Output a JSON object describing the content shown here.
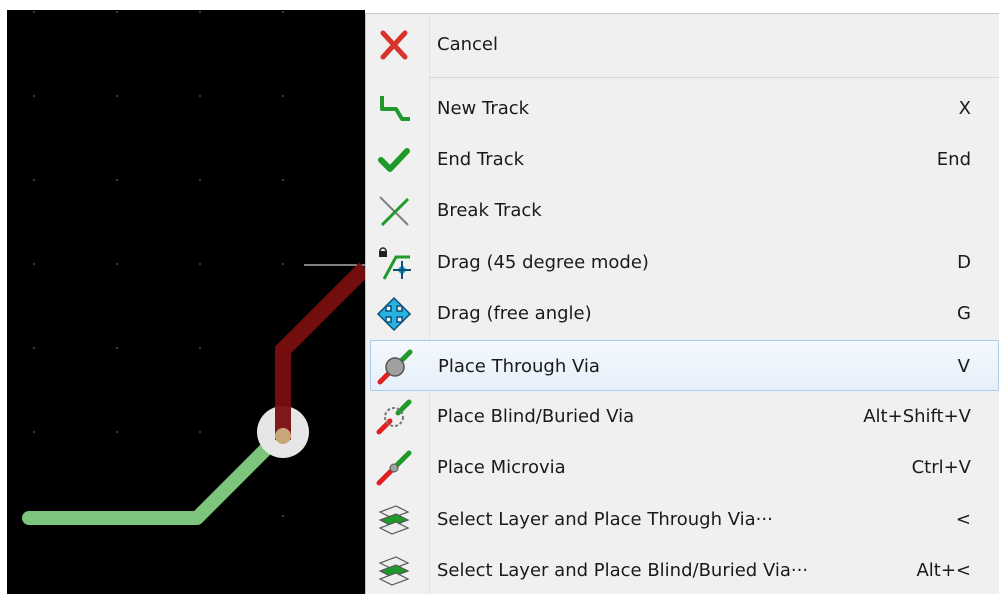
{
  "menu": {
    "items": [
      {
        "label": "Cancel",
        "shortcut": "",
        "icon": "cancel-x-icon"
      },
      {
        "label": "New Track",
        "shortcut": "X",
        "icon": "new-track-icon"
      },
      {
        "label": "End Track",
        "shortcut": "End",
        "icon": "checkmark-icon"
      },
      {
        "label": "Break Track",
        "shortcut": "",
        "icon": "break-track-icon"
      },
      {
        "label": "Drag (45 degree mode)",
        "shortcut": "D",
        "icon": "drag-45-icon"
      },
      {
        "label": "Drag (free angle)",
        "shortcut": "G",
        "icon": "move-arrows-icon"
      },
      {
        "label": "Place Through Via",
        "shortcut": "V",
        "icon": "through-via-icon"
      },
      {
        "label": "Place Blind/Buried Via",
        "shortcut": "Alt+Shift+V",
        "icon": "blind-via-icon"
      },
      {
        "label": "Place Microvia",
        "shortcut": "Ctrl+V",
        "icon": "microvia-icon"
      },
      {
        "label": "Select Layer and Place Through Via···",
        "shortcut": "<",
        "icon": "layer-stack-icon"
      },
      {
        "label": "Select Layer and Place Blind/Buried Via···",
        "shortcut": "Alt+<",
        "icon": "layer-stack-icon"
      }
    ],
    "highlighted_index": 6
  },
  "colors": {
    "canvas_bg": "#000000",
    "grid_dot": "#4a4a4a",
    "track_green": "#7dc47d",
    "track_red": "#7a0e0e",
    "via_ring": "#e6e6e6",
    "via_hole": "#c8a87a",
    "menu_bg": "#f0f0f0",
    "highlight_border": "#a8cbee"
  }
}
